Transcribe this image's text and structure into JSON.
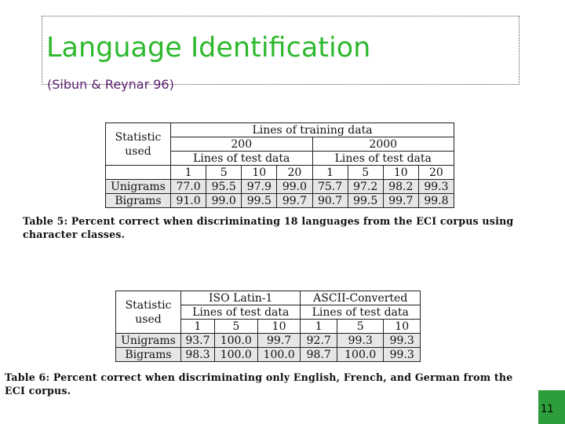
{
  "slide": {
    "title": "Language Identification",
    "subtitle": "(Sibun & Reynar 96)",
    "number": "11"
  },
  "table5": {
    "stat_header": [
      "Statistic",
      "used"
    ],
    "top_header": "Lines of training data",
    "groups": [
      "200",
      "2000"
    ],
    "sub_header": "Lines of test data",
    "columns": [
      "1",
      "5",
      "10",
      "20",
      "1",
      "5",
      "10",
      "20"
    ],
    "rows": [
      {
        "label": "Unigrams",
        "values": [
          "77.0",
          "95.5",
          "97.9",
          "99.0",
          "75.7",
          "97.2",
          "98.2",
          "99.3"
        ]
      },
      {
        "label": "Bigrams",
        "values": [
          "91.0",
          "99.0",
          "99.5",
          "99.7",
          "90.7",
          "99.5",
          "99.7",
          "99.8"
        ]
      }
    ],
    "caption": "Table 5: Percent correct when discriminating 18 languages from the ECI corpus using character classes."
  },
  "table6": {
    "stat_header": [
      "Statistic",
      "used"
    ],
    "groups": [
      "ISO Latin-1",
      "ASCII-Converted"
    ],
    "sub_header": "Lines of test data",
    "columns": [
      "1",
      "5",
      "10",
      "1",
      "5",
      "10"
    ],
    "rows": [
      {
        "label": "Unigrams",
        "values": [
          "93.7",
          "100.0",
          "99.7",
          "92.7",
          "99.3",
          "99.3"
        ]
      },
      {
        "label": "Bigrams",
        "values": [
          "98.3",
          "100.0",
          "100.0",
          "98.7",
          "100.0",
          "99.3"
        ]
      }
    ],
    "caption": "Table 6: Percent correct when discriminating only English, French, and German from the ECI corpus."
  },
  "colors": {
    "title": "#2eb82e",
    "subtitle": "#5a1e6e",
    "badge": "#2e9e3c",
    "row_shade": "#e6e6e6"
  }
}
